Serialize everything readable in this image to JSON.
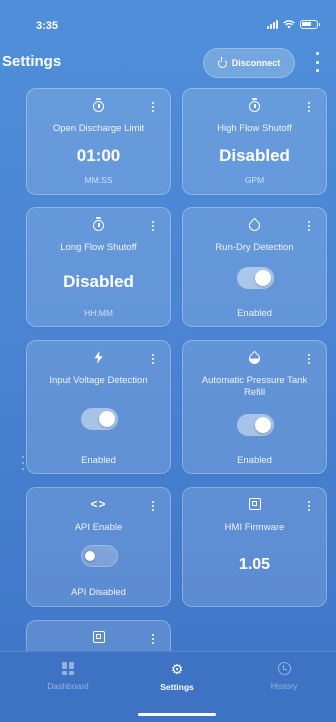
{
  "status_bar": {
    "time": "3:35"
  },
  "header": {
    "title": "Settings",
    "disconnect_label": "Disconnect"
  },
  "cards": [
    {
      "icon": "stopwatch-icon",
      "title": "Open Discharge Limit",
      "value": "01:00",
      "unit": "MM:SS"
    },
    {
      "icon": "stopwatch-icon",
      "title": "High Flow Shutoff",
      "value": "Disabled",
      "unit": "GPM"
    },
    {
      "icon": "stopwatch-icon",
      "title": "Long Flow Shutoff",
      "value": "Disabled",
      "unit": "HH:MM"
    },
    {
      "icon": "water-drop-icon",
      "title": "Run-Dry Detection",
      "toggle": "on",
      "status": "Enabled"
    },
    {
      "icon": "lightning-icon",
      "title": "Input Voltage Detection",
      "toggle": "on",
      "status": "Enabled"
    },
    {
      "icon": "half-drop-icon",
      "title": "Automatic Pressure Tank Refill",
      "toggle": "on",
      "status": "Enabled"
    },
    {
      "icon": "code-icon",
      "title": "API Enable",
      "toggle": "off",
      "status": "API Disabled"
    },
    {
      "icon": "chip-icon",
      "title": "HMI Firmware",
      "value": "1.05"
    },
    {
      "icon": "chip-icon"
    }
  ],
  "bottom_nav": [
    {
      "label": "Dashboard",
      "icon": "dashboard-icon",
      "active": false
    },
    {
      "label": "Settings",
      "icon": "gear-icon",
      "active": true
    },
    {
      "label": "History",
      "icon": "history-icon",
      "active": false
    }
  ]
}
